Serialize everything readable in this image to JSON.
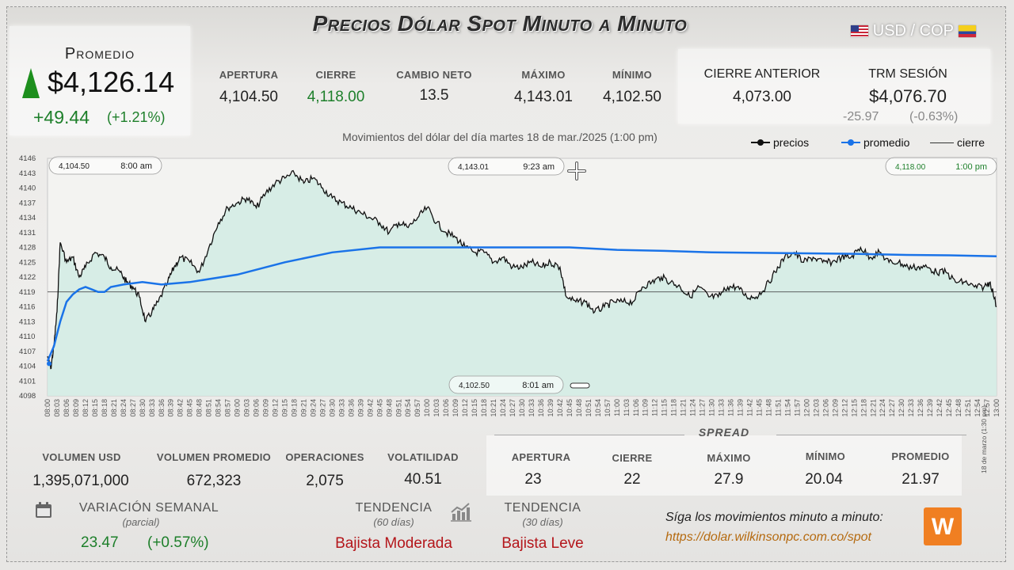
{
  "header": {
    "title": "Precios Dólar Spot Minuto a Minuto",
    "pair": "USD / COP"
  },
  "average": {
    "label": "Promedio",
    "value": "$4,126.14",
    "change": "+49.44",
    "change_pct": "(+1.21%)"
  },
  "stats": [
    {
      "label": "APERTURA",
      "value": "4,104.50"
    },
    {
      "label": "CIERRE",
      "value": "4,118.00"
    },
    {
      "label": "CAMBIO NETO",
      "value": "13.5"
    },
    {
      "label": "MÁXIMO",
      "value": "4,143.01"
    },
    {
      "label": "MÍNIMO",
      "value": "4,102.50"
    }
  ],
  "previous": {
    "close_label": "CIERRE ANTERIOR",
    "close_value": "4,073.00",
    "trm_label": "TRM SESIÓN",
    "trm_value": "$4,076.70",
    "trm_change": "-25.97",
    "trm_pct": "(-0.63%)"
  },
  "chart_data": {
    "type": "line",
    "title": "Movimientos del dólar del día martes 18 de mar./2025 (1:00 pm)",
    "legend": [
      "precios",
      "promedio",
      "cierre"
    ],
    "legend_position": "top-right",
    "ylim": [
      4098,
      4146
    ],
    "y_ticks": [
      4098,
      4101,
      4104,
      4107,
      4110,
      4113,
      4116,
      4119,
      4122,
      4125,
      4128,
      4131,
      4134,
      4137,
      4140,
      4143,
      4146
    ],
    "x_start": "08:00",
    "x_end": "13:00",
    "x_tick_step_minutes": 3,
    "close_line": 4119,
    "colors": {
      "precios": "#111111",
      "promedio": "#1a73e8",
      "cierre": "#333333",
      "fill": "#d4ece4"
    },
    "series": [
      {
        "name": "precios",
        "x": [
          "08:00",
          "08:01",
          "08:02",
          "08:03",
          "08:04",
          "08:06",
          "08:08",
          "08:10",
          "08:12",
          "08:15",
          "08:18",
          "08:20",
          "08:23",
          "08:25",
          "08:27",
          "08:29",
          "08:31",
          "08:33",
          "08:35",
          "08:38",
          "08:40",
          "08:42",
          "08:45",
          "08:48",
          "08:51",
          "08:54",
          "08:57",
          "09:00",
          "09:03",
          "09:06",
          "09:09",
          "09:12",
          "09:15",
          "09:18",
          "09:21",
          "09:24",
          "09:27",
          "09:30",
          "09:33",
          "09:36",
          "09:39",
          "09:42",
          "09:45",
          "09:48",
          "09:51",
          "09:54",
          "09:57",
          "10:00",
          "10:03",
          "10:06",
          "10:09",
          "10:12",
          "10:15",
          "10:18",
          "10:21",
          "10:24",
          "10:27",
          "10:30",
          "10:33",
          "10:36",
          "10:39",
          "10:42",
          "10:44",
          "10:47",
          "10:50",
          "10:53",
          "10:56",
          "10:59",
          "11:02",
          "11:05",
          "11:08",
          "11:11",
          "11:14",
          "11:17",
          "11:20",
          "11:23",
          "11:26",
          "11:29",
          "11:32",
          "11:35",
          "11:38",
          "11:41",
          "11:44",
          "11:47",
          "11:50",
          "11:53",
          "11:56",
          "11:59",
          "12:02",
          "12:05",
          "12:08",
          "12:11",
          "12:14",
          "12:17",
          "12:20",
          "12:23",
          "12:26",
          "12:29",
          "12:32",
          "12:35",
          "12:38",
          "12:41",
          "12:44",
          "12:47",
          "12:50",
          "12:53",
          "12:56",
          "12:58",
          "13:00"
        ],
        "values": [
          4106,
          4103.5,
          4108,
          4115,
          4129,
          4125,
          4126,
          4122,
          4124,
          4127,
          4126,
          4124,
          4123,
          4121,
          4120,
          4118,
          4113,
          4115,
          4117,
          4121,
          4124,
          4126,
          4125,
          4123,
          4128,
          4133,
          4136,
          4137,
          4138,
          4136,
          4139,
          4141,
          4142,
          4143,
          4141,
          4142,
          4140,
          4138,
          4137,
          4136,
          4135,
          4134,
          4133,
          4131,
          4133,
          4132,
          4134,
          4136,
          4133,
          4131,
          4130,
          4128,
          4127,
          4127,
          4125,
          4126,
          4124,
          4124,
          4125,
          4124,
          4125,
          4124,
          4118,
          4117,
          4117,
          4115,
          4116,
          4117,
          4117,
          4117,
          4120,
          4121,
          4122,
          4121,
          4120,
          4118,
          4120,
          4118,
          4118,
          4120,
          4120,
          4118,
          4118,
          4120,
          4123,
          4126,
          4127,
          4125,
          4126,
          4125,
          4125,
          4126,
          4126,
          4128,
          4126,
          4127,
          4125,
          4125,
          4124,
          4124,
          4124,
          4123,
          4123,
          4121,
          4121,
          4120,
          4120,
          4121,
          4116
        ]
      },
      {
        "name": "promedio",
        "x": [
          "08:00",
          "08:02",
          "08:04",
          "08:06",
          "08:08",
          "08:10",
          "08:12",
          "08:14",
          "08:16",
          "08:18",
          "08:20",
          "08:24",
          "08:30",
          "08:36",
          "08:45",
          "09:00",
          "09:15",
          "09:30",
          "09:45",
          "10:00",
          "10:15",
          "10:30",
          "10:45",
          "11:00",
          "11:15",
          "11:30",
          "11:45",
          "12:00",
          "12:15",
          "12:30",
          "12:45",
          "13:00"
        ],
        "values": [
          4105,
          4108,
          4113,
          4117,
          4118.5,
          4119.5,
          4120,
          4119.5,
          4119,
          4119,
          4120,
          4120.5,
          4121,
          4120.5,
          4121,
          4122.5,
          4125,
          4127,
          4128,
          4128,
          4128,
          4128,
          4128,
          4127.5,
          4127.3,
          4127,
          4126.9,
          4126.8,
          4126.7,
          4126.5,
          4126.4,
          4126.2
        ]
      }
    ],
    "annotations": [
      {
        "price": "4,104.50",
        "time": "8:00 am"
      },
      {
        "price": "4,143.01",
        "time": "9:23 am"
      },
      {
        "price": "4,118.00",
        "time": "1:00 pm"
      },
      {
        "price": "4,102.50",
        "time": "8:01 am"
      }
    ]
  },
  "bottom": {
    "stats": [
      {
        "label": "VOLUMEN USD",
        "value": "1,395,071,000"
      },
      {
        "label": "VOLUMEN PROMEDIO",
        "value": "672,323"
      },
      {
        "label": "OPERACIONES",
        "value": "2,075"
      },
      {
        "label": "VOLATILIDAD",
        "value": "40.51"
      }
    ],
    "spread_title": "SPREAD",
    "spread": [
      {
        "label": "APERTURA",
        "value": "23"
      },
      {
        "label": "CIERRE",
        "value": "22"
      },
      {
        "label": "MÁXIMO",
        "value": "27.9"
      },
      {
        "label": "MÍNIMO",
        "value": "20.04"
      },
      {
        "label": "PROMEDIO",
        "value": "21.97"
      }
    ],
    "weekly": {
      "label": "VARIACIÓN SEMANAL",
      "sub": "(parcial)",
      "value": "23.47",
      "pct": "(+0.57%)"
    },
    "trend60": {
      "label": "TENDENCIA",
      "sub": "(60 días)",
      "value": "Bajista Moderada"
    },
    "trend30": {
      "label": "TENDENCIA",
      "sub": "(30 días)",
      "value": "Bajista Leve"
    },
    "follow": "Síga los movimientos minuto a minuto:",
    "url": "https://dolar.wilkinsonpc.com.co/spot",
    "logo": "W",
    "stamp": "18 de marzo (1:30 pm)"
  },
  "icons": {
    "calendar": "calendar-icon",
    "trend": "bar-chart-icon"
  }
}
